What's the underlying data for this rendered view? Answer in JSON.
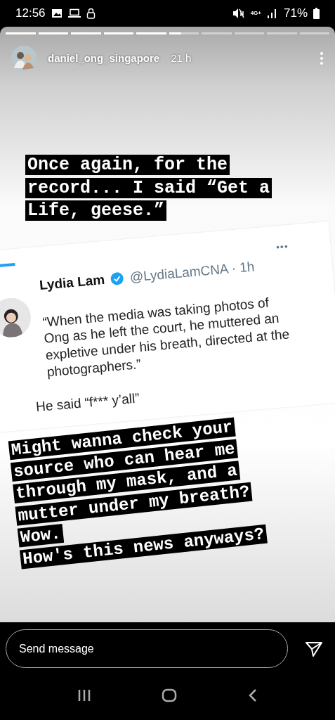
{
  "status_bar": {
    "time": "12:56",
    "network": "4G+",
    "battery": "71%"
  },
  "story": {
    "progress": [
      {
        "level": 1
      },
      {
        "level": 1
      },
      {
        "level": 1
      },
      {
        "level": 1
      },
      {
        "level": 1
      },
      {
        "level": 0.4
      },
      {
        "level": 0
      },
      {
        "level": 0
      },
      {
        "level": 0
      },
      {
        "level": 0
      }
    ],
    "username": "daniel_ong_singapore",
    "age": "21 h",
    "caption_top": [
      "Once again, for the",
      "record... I said “Get a",
      "Life, geese.”"
    ],
    "tweet": {
      "name": "Lydia Lam",
      "verified": true,
      "handle": "@LydiaLamCNA · 1h",
      "more": "•••",
      "body": "“When the media was taking photos of Ong as he left the court, he muttered an expletive under his breath, directed at the photographers.”",
      "reply": "He said “f*** y’all”"
    },
    "caption_bottom": [
      "Might wanna check your",
      "source who can hear me",
      "through my mask, and a",
      "mutter under my breath?",
      "Wow.",
      "How's this news anyways?"
    ]
  },
  "message": {
    "placeholder": "Send message"
  }
}
